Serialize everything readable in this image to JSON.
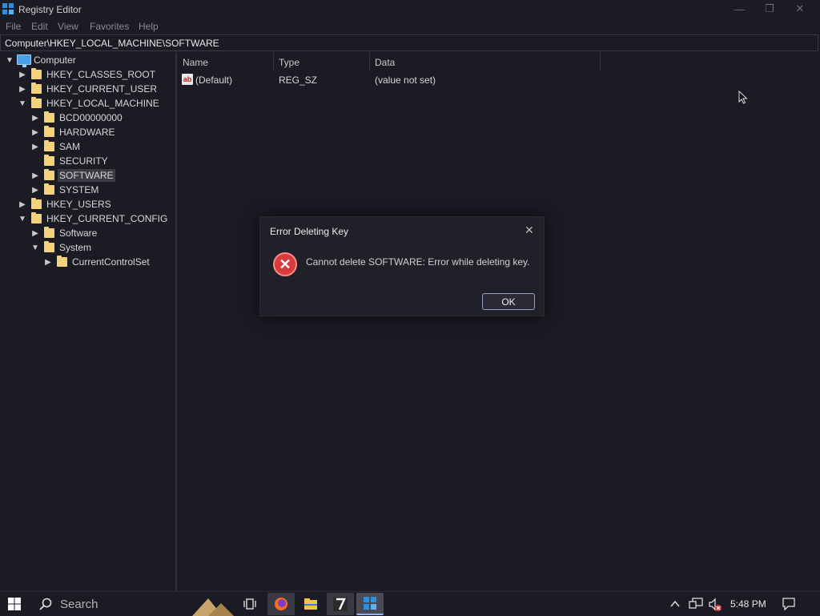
{
  "window": {
    "title": "Registry Editor",
    "controls": {
      "minimize": "—",
      "maximize": "❐",
      "close": "✕"
    }
  },
  "menu": [
    "File",
    "Edit",
    "View",
    "Favorites",
    "Help"
  ],
  "address": "Computer\\HKEY_LOCAL_MACHINE\\SOFTWARE",
  "tree": [
    {
      "label": "Computer"
    },
    {
      "label": "HKEY_CLASSES_ROOT"
    },
    {
      "label": "HKEY_CURRENT_USER"
    },
    {
      "label": "HKEY_LOCAL_MACHINE"
    },
    {
      "label": "BCD00000000"
    },
    {
      "label": "HARDWARE"
    },
    {
      "label": "SAM"
    },
    {
      "label": "SECURITY"
    },
    {
      "label": "SOFTWARE"
    },
    {
      "label": "SYSTEM"
    },
    {
      "label": "HKEY_USERS"
    },
    {
      "label": "HKEY_CURRENT_CONFIG"
    },
    {
      "label": "Software"
    },
    {
      "label": "System"
    },
    {
      "label": "CurrentControlSet"
    }
  ],
  "list": {
    "columns": [
      "Name",
      "Type",
      "Data"
    ],
    "rows": [
      {
        "name": "(Default)",
        "type": "REG_SZ",
        "data": "(value not set)",
        "icon": "ab"
      }
    ]
  },
  "dialog": {
    "title": "Error Deleting Key",
    "message": "Cannot delete SOFTWARE:  Error while deleting key.",
    "ok": "OK",
    "close": "✕",
    "icon": "✕"
  },
  "taskbar": {
    "search_placeholder": "Search",
    "clock": "5:48 PM",
    "pinned": [
      "task-view",
      "firefox",
      "file-explorer",
      "7-zip",
      "registry-editor"
    ]
  },
  "colors": {
    "background": "#1b1b24",
    "folder": "#f3d27a",
    "error": "#d83b3b",
    "selection": "#3b3b44"
  }
}
